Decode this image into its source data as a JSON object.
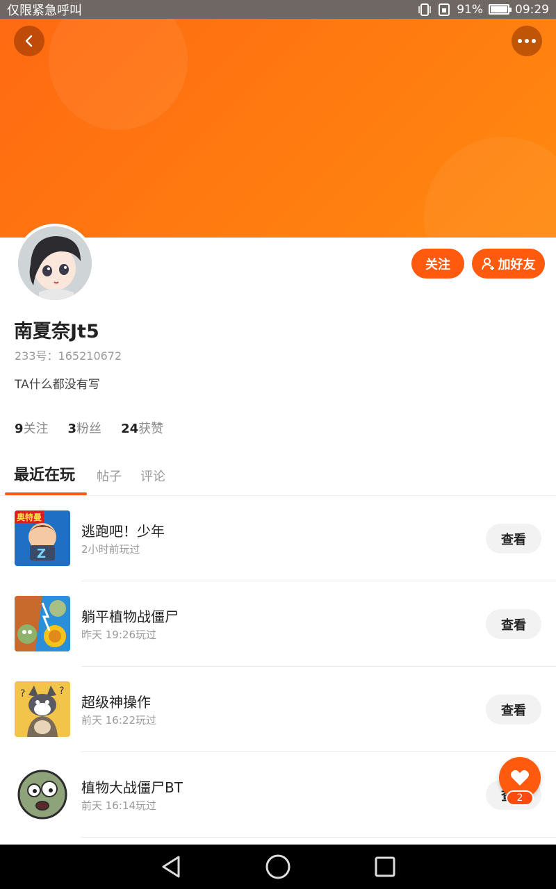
{
  "status_bar": {
    "left_text": "仅限紧急呼叫",
    "battery_text": "91%",
    "battery_level": 0.91,
    "time": "09:29"
  },
  "header": {
    "back_icon": "chevron-left-icon",
    "more_icon": "more-dots-icon"
  },
  "profile": {
    "follow_label": "关注",
    "add_friend_label": "加好友",
    "add_friend_icon": "person-add-icon",
    "name": "南夏奈Jt5",
    "id_text": "233号：165210672",
    "bio": "TA什么都没有写"
  },
  "stats": [
    {
      "num": "9",
      "label": "关注"
    },
    {
      "num": "3",
      "label": "粉丝"
    },
    {
      "num": "24",
      "label": "获赞"
    }
  ],
  "tabs": [
    {
      "label": "最近在玩"
    },
    {
      "label": "帖子"
    },
    {
      "label": "评论"
    }
  ],
  "games": [
    {
      "name": "逃跑吧！少年",
      "time": "2小时前玩过",
      "button": "查看",
      "icon_badge": "奥特曼"
    },
    {
      "name": "躺平植物战僵尸",
      "time": "昨天 19:26玩过",
      "button": "查看"
    },
    {
      "name": "超级神操作",
      "time": "前天 16:22玩过",
      "button": "查看"
    },
    {
      "name": "植物大战僵尸BT",
      "time": "前天 16:14玩过",
      "button": "查看"
    }
  ],
  "fab": {
    "icon": "heart-icon",
    "badge": "2"
  },
  "colors": {
    "accent": "#ff5a0d",
    "banner": "#ff7b10"
  }
}
